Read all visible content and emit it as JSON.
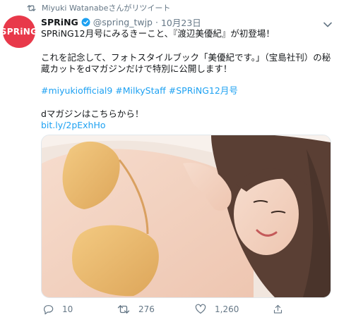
{
  "retweet": {
    "text": "Miyuki Watanabeさんがリツイート"
  },
  "avatar": {
    "label": "SPRiNG"
  },
  "tweet": {
    "name": "SPRiNG",
    "handle": "@spring_twjp",
    "separator": "·",
    "date": "10月23日",
    "lines": [
      "SPRiNG12月号にみるきーこと、『渡辺美優紀』が初登場！",
      "これを記念して、フォトスタイルブック「美優紀です。」（宝島社刊）の秘",
      "蔵カットをdマガジンだけで特別に公開します！",
      "#miyukiofficial9 #MilkyStaff #SPRiNG12月号",
      "dマガジンはこちらから！",
      "bit.ly/2pExhHo"
    ]
  },
  "actions": {
    "replies": "10",
    "retweets": "276",
    "likes": "1,260"
  },
  "colors": {
    "accent": "#1da1f2",
    "brand": "#e8394a",
    "muted": "#657786",
    "retweet_green": "#17bf63"
  },
  "icons": [
    "retweet-icon",
    "verified-badge-icon",
    "chevron-down-icon",
    "reply-icon",
    "retweet-icon",
    "like-icon",
    "share-icon"
  ]
}
